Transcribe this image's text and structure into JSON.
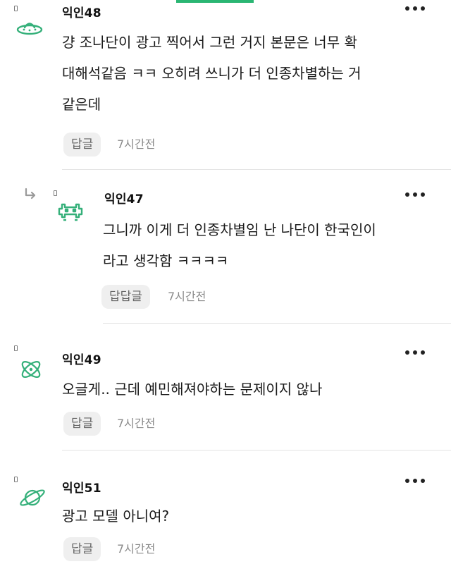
{
  "theme": {
    "accent": "#2ab673",
    "avatar_green": "#35b07a",
    "text": "#111111",
    "muted": "#8a8a8a",
    "button_bg": "#efefef"
  },
  "comments": [
    {
      "nickname": "익인48",
      "avatar_icon": "ufo-icon",
      "lines": [
        "걍 조나단이 광고 찍어서 그런 거지 본문은 너무 확",
        "대해석같음 ㅋㅋ 오히려 쓰니가 더 인종차별하는 거",
        "같은데"
      ],
      "reply_label": "답글",
      "time": "7시간전"
    },
    {
      "nickname": "익인47",
      "avatar_icon": "space-invader-icon",
      "is_reply": true,
      "lines": [
        "그니까 이게 더 인종차별임 난 나단이 한국인이",
        "라고 생각함 ㅋㅋㅋㅋ"
      ],
      "reply_label": "답답글",
      "time": "7시간전"
    },
    {
      "nickname": "익인49",
      "avatar_icon": "atom-icon",
      "lines": [
        "오글게.. 근데 예민해져야하는 문제이지 않나"
      ],
      "reply_label": "답글",
      "time": "7시간전"
    },
    {
      "nickname": "익인51",
      "avatar_icon": "planet-icon",
      "lines": [
        "광고 모델 아니여?"
      ],
      "reply_label": "답글",
      "time": "7시간전"
    }
  ]
}
